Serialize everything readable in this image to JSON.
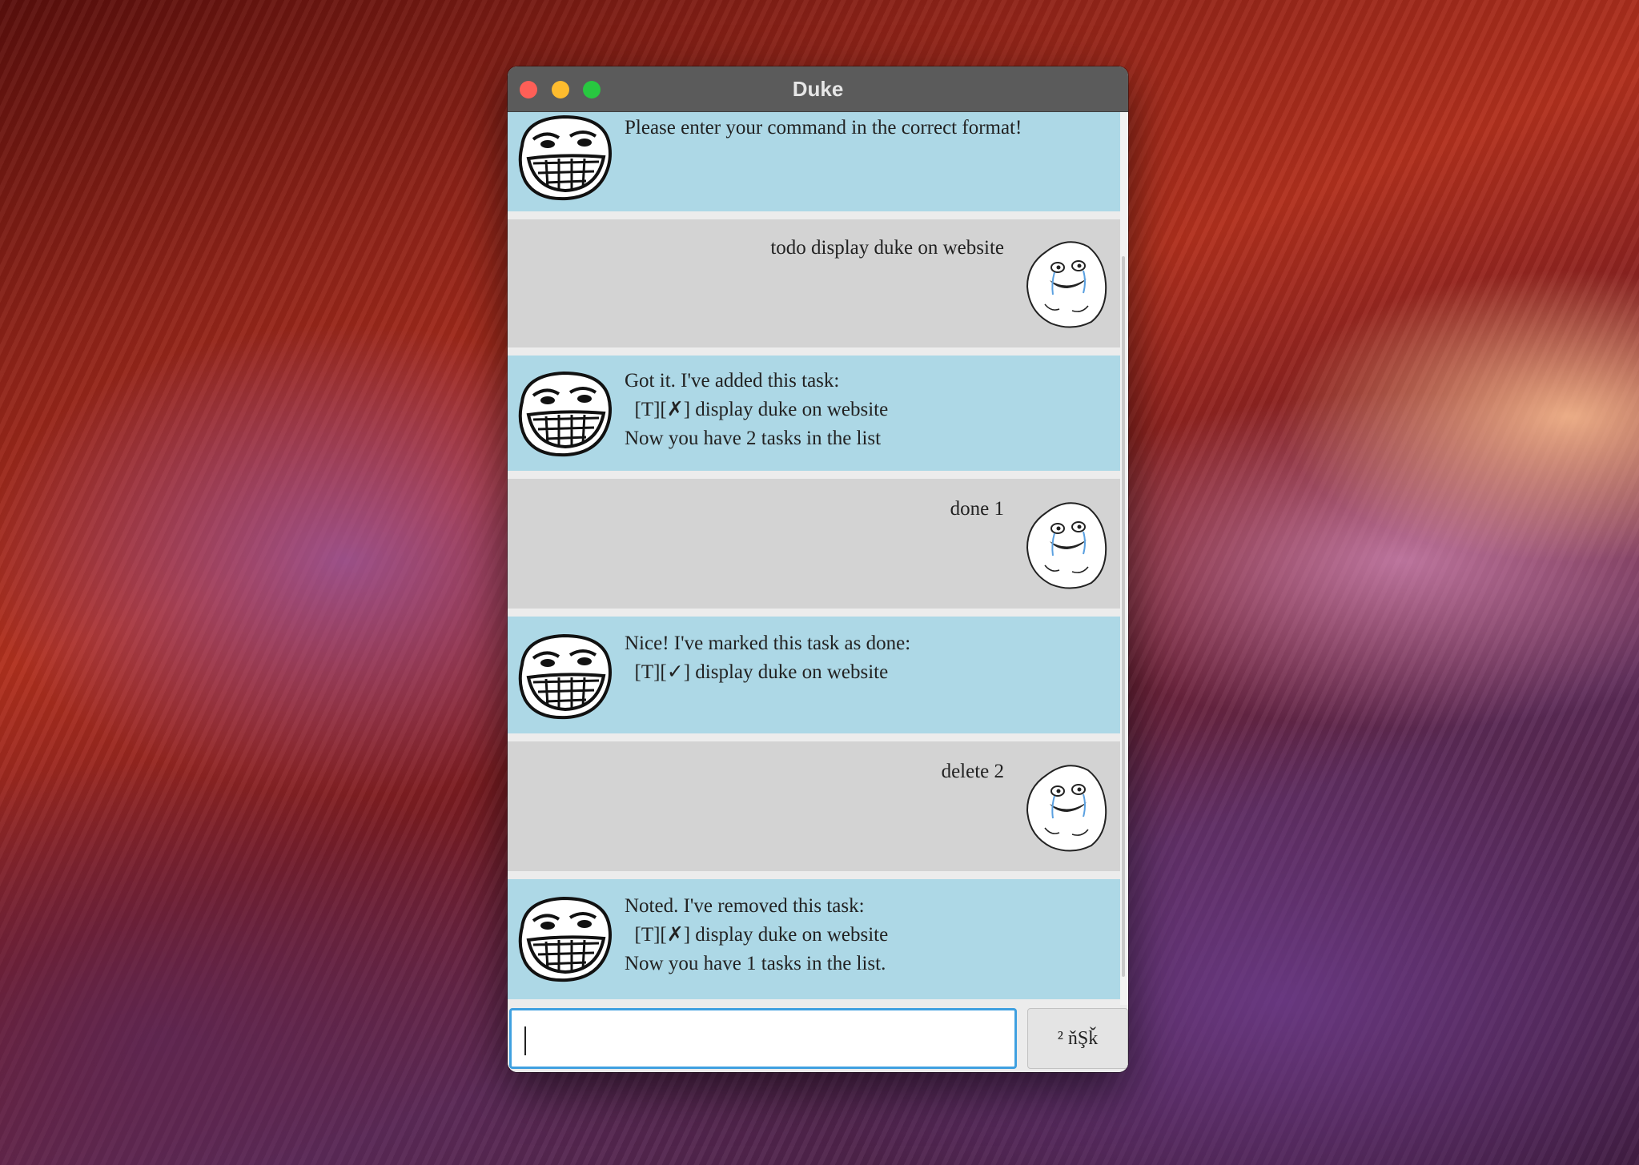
{
  "window": {
    "title": "Duke"
  },
  "messages": [
    {
      "sender": "duke",
      "text": "Please enter your command in the correct format!"
    },
    {
      "sender": "user",
      "text": "todo display duke on website"
    },
    {
      "sender": "duke",
      "text": "Got it. I've added this task:\n  [T][✗] display duke on website\nNow you have 2 tasks in the list"
    },
    {
      "sender": "user",
      "text": "done 1"
    },
    {
      "sender": "duke",
      "text": "Nice! I've marked this task as done:\n  [T][✓] display duke on website"
    },
    {
      "sender": "user",
      "text": "delete 2"
    },
    {
      "sender": "duke",
      "text": "Noted. I've removed this task:\n  [T][✗] display duke on website\nNow you have 1 tasks in the list."
    }
  ],
  "input": {
    "value": ""
  },
  "send_button": {
    "label": "² ňŞǩ"
  },
  "icons": {
    "duke_avatar": "troll-face-icon",
    "user_avatar": "forever-alone-face-icon"
  }
}
